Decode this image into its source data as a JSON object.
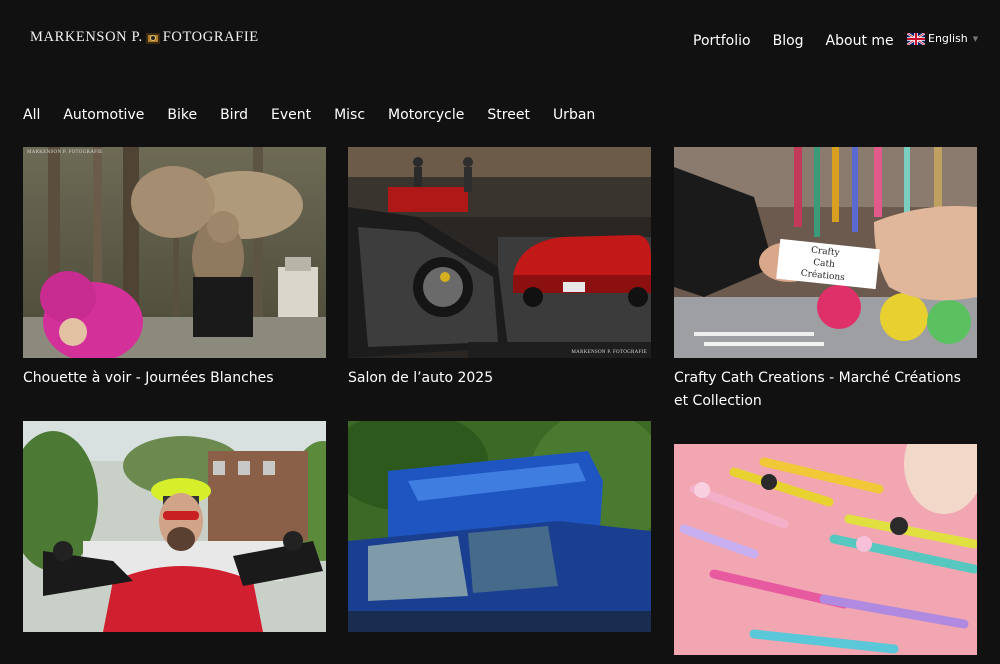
{
  "header": {
    "logo_left": "MARKENSON P.",
    "logo_right": "FOTOGRAFIE"
  },
  "nav": {
    "items": [
      "Portfolio",
      "Blog",
      "About me"
    ],
    "language": "English",
    "flag_icon": "uk-flag-icon"
  },
  "filters": [
    "All",
    "Automotive",
    "Bike",
    "Bird",
    "Event",
    "Misc",
    "Motorcycle",
    "Street",
    "Urban"
  ],
  "watermark": "MARKENSON P. FOTOGRAFIE",
  "posts": [
    {
      "title": "Chouette à voir - Journées Blanches"
    },
    {
      "title": "Salon de l’auto 2025"
    },
    {
      "title": "Crafty Cath Creations - Marché Créations et Collection",
      "sign_text": "Crafty Cath Créations"
    },
    {
      "title": ""
    },
    {
      "title": ""
    },
    {
      "title": ""
    }
  ],
  "colors": {
    "background": "#111111",
    "text": "#ffffff"
  }
}
